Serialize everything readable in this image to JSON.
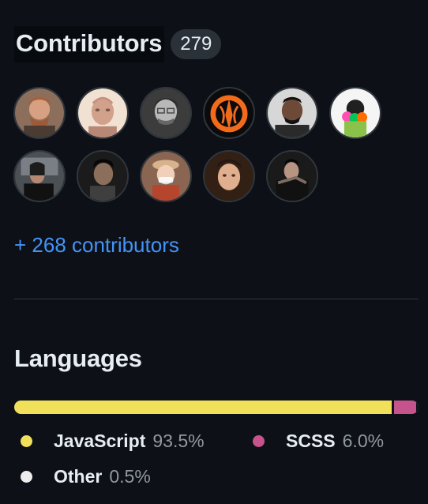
{
  "contributors": {
    "title": "Contributors",
    "count": "279",
    "more_link": "+ 268 contributors"
  },
  "languages": {
    "title": "Languages",
    "items": [
      {
        "name": "JavaScript",
        "percent": "93.5%",
        "value": 93.5,
        "color": "#f1e05a"
      },
      {
        "name": "SCSS",
        "percent": "6.0%",
        "value": 6.0,
        "color": "#c6538c"
      },
      {
        "name": "Other",
        "percent": "0.5%",
        "value": 0.5,
        "color": "#ededed"
      }
    ]
  },
  "theme": {
    "background": "#0d1117",
    "text": "#e6edf3",
    "muted": "#9198a1",
    "link": "#4493f8",
    "border": "#30363d"
  }
}
